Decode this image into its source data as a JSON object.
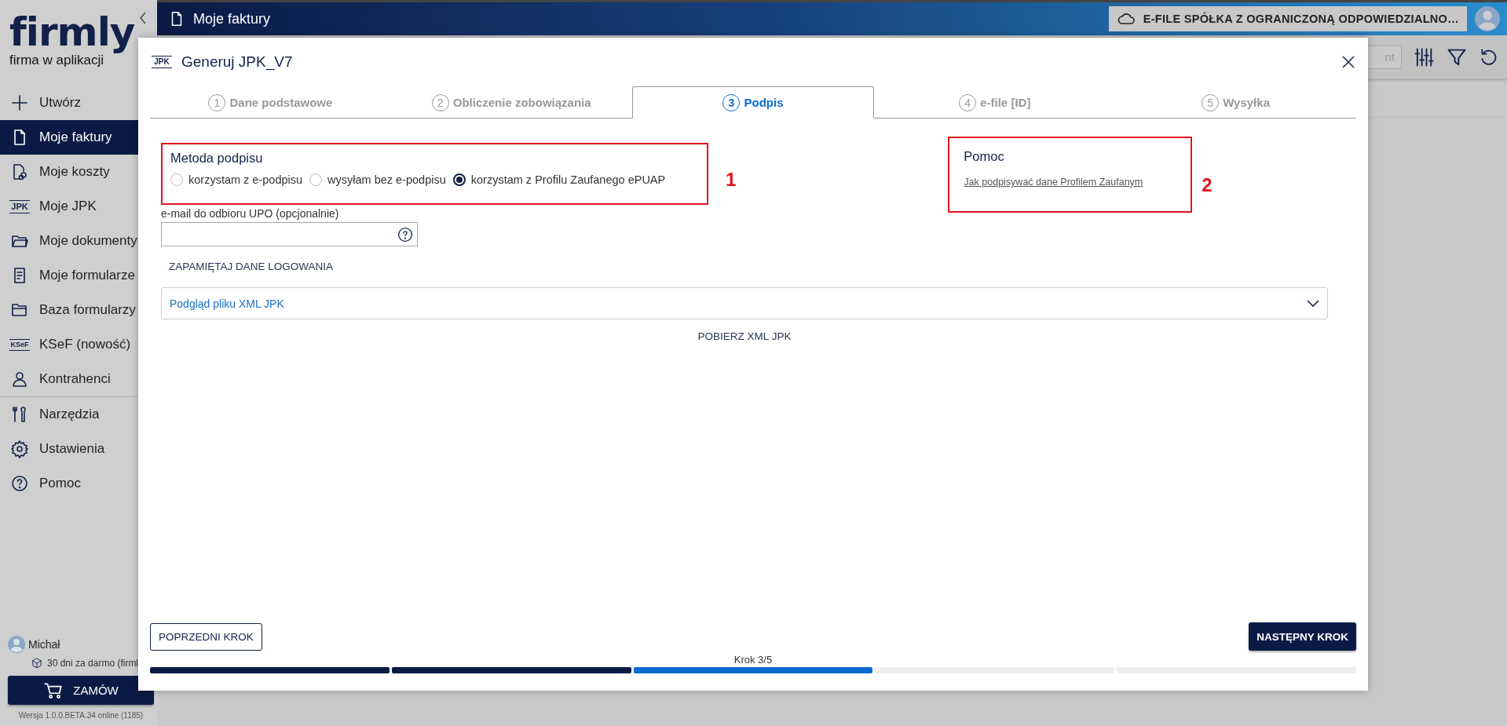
{
  "sidebar": {
    "logo": "firmly",
    "tagline": "firma w aplikacji",
    "items": [
      {
        "label": "Utwórz",
        "selected": false
      },
      {
        "label": "Moje faktury",
        "selected": true
      },
      {
        "label": "Moje koszty",
        "selected": false
      },
      {
        "label": "Moje JPK",
        "icon_text": "JPK",
        "selected": false
      },
      {
        "label": "Moje dokumenty",
        "selected": false
      },
      {
        "label": "Moje formularze",
        "selected": false
      },
      {
        "label": "Baza formularzy",
        "selected": false
      },
      {
        "label": "KSeF (nowość)",
        "icon_text": "KSeF",
        "selected": false
      },
      {
        "label": "Kontrahenci",
        "selected": false
      }
    ],
    "items_secondary": [
      {
        "label": "Narzędzia",
        "selected": false
      },
      {
        "label": "Ustawienia",
        "selected": false
      },
      {
        "label": "Pomoc",
        "selected": false
      }
    ],
    "user": {
      "name": "Michał",
      "plan": "30 dni za darmo (firml"
    },
    "order_button": "ZAMÓW",
    "version": "Wersja 1.0.0.BETA.34 online (1185)"
  },
  "top_bar": {
    "title": "Moje faktury",
    "company": "E-FILE SPÓŁKA Z OGRANICZONĄ ODPOWIEDZIALNO…"
  },
  "toolbar": {
    "search": {
      "placeholder": "nt"
    }
  },
  "dialog": {
    "icon_text": "JPK",
    "title": "Generuj JPK_V7",
    "steps": [
      {
        "number": "1",
        "label": "Dane podstawowe",
        "selected": false
      },
      {
        "number": "2",
        "label": "Obliczenie zobowiązania",
        "selected": false
      },
      {
        "number": "3",
        "label": "Podpis",
        "selected": true
      },
      {
        "number": "4",
        "label": "e-file [ID]",
        "selected": false
      },
      {
        "number": "5",
        "label": "Wysyłka",
        "selected": false
      }
    ],
    "signature": {
      "title": "Metoda podpisu",
      "annotation": "1",
      "options": [
        {
          "label": "korzystam z e-podpisu",
          "selected": false
        },
        {
          "label": "wysyłam bez e-podpisu",
          "selected": false
        },
        {
          "label": "korzystam z Profilu Zaufanego ePUAP",
          "selected": true
        }
      ]
    },
    "email": {
      "label": "e-mail do odbioru UPO (opcjonalnie)"
    },
    "remember_button": "ZAPAMIĘTAJ DANE LOGOWANIA",
    "xml_preview": {
      "label": "Podgląd pliku XML JPK",
      "expanded": false
    },
    "download_button": "POBIERZ XML JPK",
    "help": {
      "title": "Pomoc",
      "link": "Jak podpisywać dane Profilem Zaufanym",
      "annotation": "2"
    },
    "prev_button": "POPRZEDNI KROK",
    "next_button": "NASTĘPNY KROK",
    "progress_label": "Krok 3/5",
    "progress": [
      {
        "kind": "done"
      },
      {
        "kind": "done"
      },
      {
        "kind": "current"
      },
      {
        "kind": "pending"
      },
      {
        "kind": "pending"
      }
    ]
  }
}
